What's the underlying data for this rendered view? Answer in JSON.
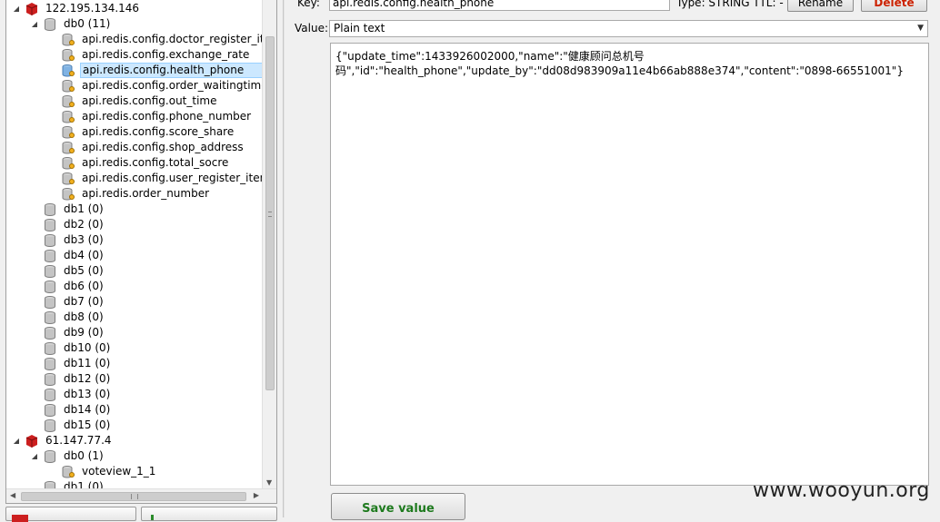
{
  "tree": {
    "servers": [
      {
        "host": "122.195.134.146",
        "databases": [
          {
            "label": "db0 (11)",
            "keys": [
              "api.redis.config.doctor_register_item",
              "api.redis.config.exchange_rate",
              "api.redis.config.health_phone",
              "api.redis.config.order_waitingtime",
              "api.redis.config.out_time",
              "api.redis.config.phone_number",
              "api.redis.config.score_share",
              "api.redis.config.shop_address",
              "api.redis.config.total_socre",
              "api.redis.config.user_register_item",
              "api.redis.order_number"
            ]
          },
          {
            "label": "db1 (0)"
          },
          {
            "label": "db2 (0)"
          },
          {
            "label": "db3 (0)"
          },
          {
            "label": "db4 (0)"
          },
          {
            "label": "db5 (0)"
          },
          {
            "label": "db6 (0)"
          },
          {
            "label": "db7 (0)"
          },
          {
            "label": "db8 (0)"
          },
          {
            "label": "db9 (0)"
          },
          {
            "label": "db10 (0)"
          },
          {
            "label": "db11 (0)"
          },
          {
            "label": "db12 (0)"
          },
          {
            "label": "db13 (0)"
          },
          {
            "label": "db14 (0)"
          },
          {
            "label": "db15 (0)"
          }
        ]
      },
      {
        "host": "61.147.77.4",
        "databases": [
          {
            "label": "db0 (1)",
            "keys": [
              "voteview_1_1"
            ]
          },
          {
            "label": "db1 (0)"
          }
        ]
      }
    ],
    "selected_key": "api.redis.config.health_phone"
  },
  "editor": {
    "key_label": "Key:",
    "key_value": "api.redis.config.health_phone",
    "type_text": "Type: STRING  TTL: -",
    "rename_label": "Rename",
    "delete_label": "Delete",
    "value_label": "Value:",
    "value_format": "Plain text",
    "value_content": "{\"update_time\":1433926002000,\"name\":\"健康顾问总机号\n码\",\"id\":\"health_phone\",\"update_by\":\"dd08d983909a11e4b66ab888e374\",\"content\":\"0898-66551001\"}",
    "save_label": "Save value"
  },
  "watermark": "www.wooyun.org",
  "colors": {
    "server_icon": "#cc1f1f",
    "selection": "#cce8ff",
    "save_text": "#1e7a1e",
    "delete_text": "#cc2200"
  }
}
